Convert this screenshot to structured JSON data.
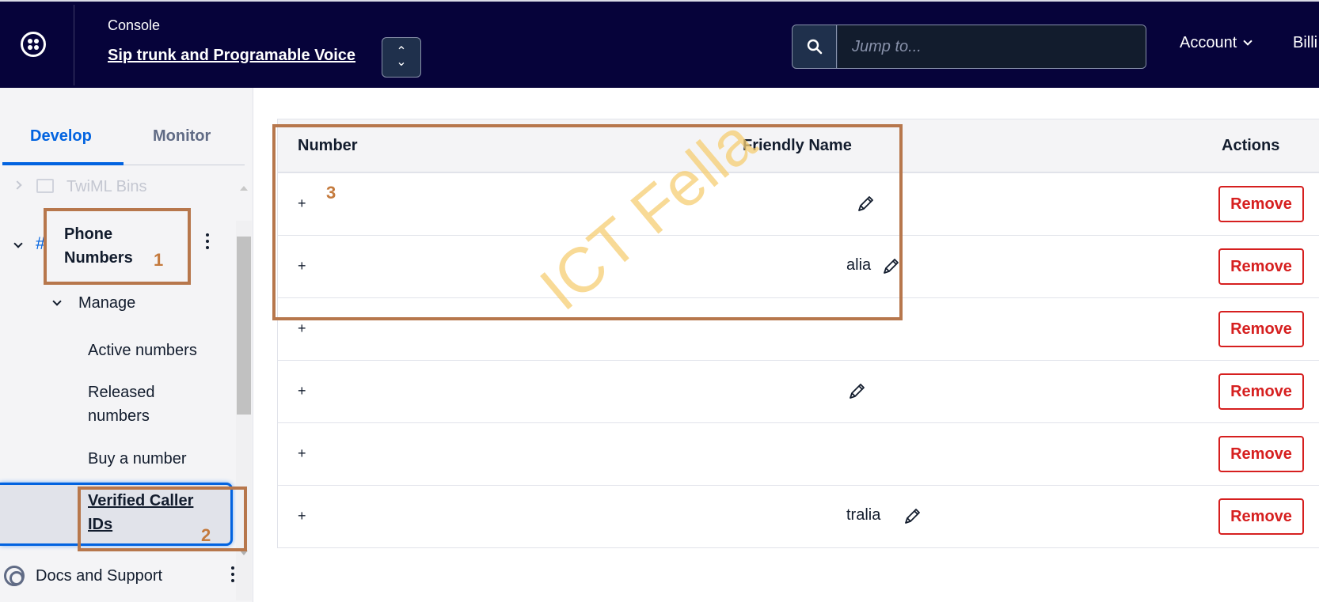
{
  "header": {
    "console_label": "Console",
    "project_name": "Sip trunk and Programable Voice",
    "search": {
      "placeholder": "Jump to..."
    },
    "menu": {
      "account": "Account",
      "billing": "Billi"
    }
  },
  "sidebar": {
    "tabs": [
      "Develop",
      "Monitor"
    ],
    "twiml_bins": "TwiML Bins",
    "phone_numbers": "Phone Numbers",
    "manage": "Manage",
    "items": [
      "Active numbers",
      "Released numbers",
      "Buy a number",
      "Verified Caller IDs"
    ],
    "docs_support": "Docs and Support"
  },
  "annotations": [
    "1",
    "2",
    "3"
  ],
  "table": {
    "columns": [
      "Number",
      "Friendly Name",
      "Actions"
    ],
    "rows": [
      {
        "number": "+",
        "friendly_name": "",
        "action": "Remove"
      },
      {
        "number": "+",
        "friendly_name": "alia",
        "action": "Remove"
      },
      {
        "number": "+",
        "friendly_name": "",
        "action": "Remove"
      },
      {
        "number": "+",
        "friendly_name": "",
        "action": "Remove"
      },
      {
        "number": "+",
        "friendly_name": "",
        "action": "Remove"
      },
      {
        "number": "+",
        "friendly_name": "tralia",
        "action": "Remove"
      }
    ]
  },
  "watermark": "ICT Fella",
  "colors": {
    "nav_bg": "#06033a",
    "accent_blue": "#0263e0",
    "remove_red": "#d61f1f",
    "annotation": "#b7774c"
  }
}
